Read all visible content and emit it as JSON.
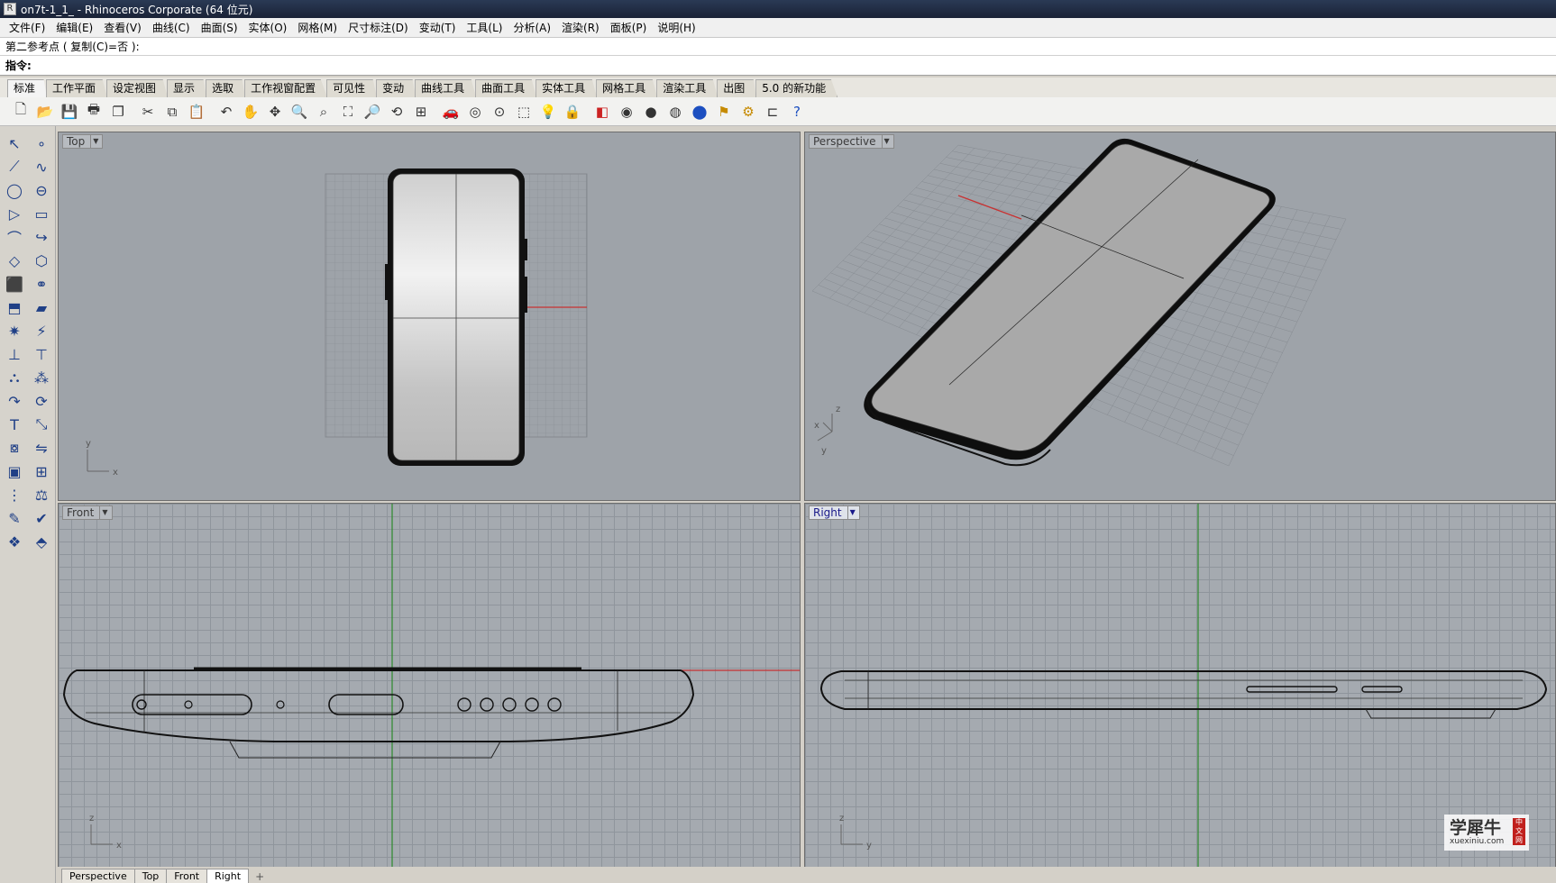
{
  "window": {
    "title": "on7t-1_1_ - Rhinoceros Corporate (64 位元)"
  },
  "menubar": {
    "items": [
      "文件(F)",
      "编辑(E)",
      "查看(V)",
      "曲线(C)",
      "曲面(S)",
      "实体(O)",
      "网格(M)",
      "尺寸标注(D)",
      "变动(T)",
      "工具(L)",
      "分析(A)",
      "渲染(R)",
      "面板(P)",
      "说明(H)"
    ]
  },
  "command": {
    "history": "第二参考点 ( 复制(C)=否 ):",
    "prompt": "指令:",
    "value": ""
  },
  "tabs": [
    "标准",
    "工作平面",
    "设定视图",
    "显示",
    "选取",
    "工作视窗配置",
    "可见性",
    "变动",
    "曲线工具",
    "曲面工具",
    "实体工具",
    "网格工具",
    "渲染工具",
    "出图",
    "5.0 的新功能"
  ],
  "toolbar": {
    "icons": [
      {
        "name": "new-file-icon",
        "glyph": "🗋"
      },
      {
        "name": "open-folder-icon",
        "glyph": "📂"
      },
      {
        "name": "save-icon",
        "glyph": "💾"
      },
      {
        "name": "print-icon",
        "glyph": "🖶"
      },
      {
        "name": "copy-file-icon",
        "glyph": "❐"
      },
      {
        "name": "cut-icon",
        "glyph": "✂"
      },
      {
        "name": "copy-icon",
        "glyph": "⧉"
      },
      {
        "name": "paste-icon",
        "glyph": "📋"
      },
      {
        "name": "undo-icon",
        "glyph": "↶"
      },
      {
        "name": "pan-hand-icon",
        "glyph": "✋"
      },
      {
        "name": "move-view-icon",
        "glyph": "✥"
      },
      {
        "name": "zoom-icon",
        "glyph": "🔍"
      },
      {
        "name": "zoom-window-icon",
        "glyph": "⌕"
      },
      {
        "name": "zoom-extents-icon",
        "glyph": "⛶"
      },
      {
        "name": "zoom-selected-icon",
        "glyph": "🔎"
      },
      {
        "name": "rotate-view-icon",
        "glyph": "⟲"
      },
      {
        "name": "four-viewports-icon",
        "glyph": "⊞"
      },
      {
        "name": "car-icon",
        "glyph": "🚗"
      },
      {
        "name": "grid-snap-icon",
        "glyph": "◎"
      },
      {
        "name": "osnap-icon",
        "glyph": "⊙"
      },
      {
        "name": "select-icon",
        "glyph": "⬚"
      },
      {
        "name": "lightbulb-icon",
        "glyph": "💡"
      },
      {
        "name": "lock-icon",
        "glyph": "🔒"
      },
      {
        "name": "layers-icon",
        "glyph": "◧"
      },
      {
        "name": "color-wheel-icon",
        "glyph": "◉"
      },
      {
        "name": "shaded-sphere-icon",
        "glyph": "●"
      },
      {
        "name": "rendered-sphere-icon",
        "glyph": "◍"
      },
      {
        "name": "blue-sphere-icon",
        "glyph": "⬤"
      },
      {
        "name": "flag-icon",
        "glyph": "⚑"
      },
      {
        "name": "options-gear-icon",
        "glyph": "⚙"
      },
      {
        "name": "dimension-icon",
        "glyph": "⊏"
      },
      {
        "name": "help-icon",
        "glyph": "?"
      }
    ]
  },
  "lefttools": {
    "icons": [
      {
        "name": "select-arrow-icon",
        "glyph": "↖"
      },
      {
        "name": "point-icon",
        "glyph": "∘"
      },
      {
        "name": "polyline-icon",
        "glyph": "⟋"
      },
      {
        "name": "curve-icon",
        "glyph": "∿"
      },
      {
        "name": "circle-icon",
        "glyph": "◯"
      },
      {
        "name": "ellipse-icon",
        "glyph": "⊖"
      },
      {
        "name": "polygon-icon",
        "glyph": "▷"
      },
      {
        "name": "rectangle-icon",
        "glyph": "▭"
      },
      {
        "name": "arc-icon",
        "glyph": "⌒"
      },
      {
        "name": "fillet-icon",
        "glyph": "↪"
      },
      {
        "name": "surface-icon",
        "glyph": "◇"
      },
      {
        "name": "loft-icon",
        "glyph": "⬡"
      },
      {
        "name": "box-icon",
        "glyph": "⬛"
      },
      {
        "name": "boolean-icon",
        "glyph": "⚭"
      },
      {
        "name": "extrude-icon",
        "glyph": "⬒"
      },
      {
        "name": "plane-icon",
        "glyph": "▰"
      },
      {
        "name": "explode-icon",
        "glyph": "✷"
      },
      {
        "name": "lightning-icon",
        "glyph": "⚡"
      },
      {
        "name": "trim-icon",
        "glyph": "⊥"
      },
      {
        "name": "split-icon",
        "glyph": "⊤"
      },
      {
        "name": "group-icon",
        "glyph": "⛬"
      },
      {
        "name": "ungroup-icon",
        "glyph": "⁂"
      },
      {
        "name": "rotate-icon",
        "glyph": "↷"
      },
      {
        "name": "rotate-3d-icon",
        "glyph": "⟳"
      },
      {
        "name": "text-icon",
        "glyph": "T"
      },
      {
        "name": "scale-icon",
        "glyph": "⤡"
      },
      {
        "name": "array-icon",
        "glyph": "⧇"
      },
      {
        "name": "mirror-icon",
        "glyph": "⇋"
      },
      {
        "name": "solid-box-icon",
        "glyph": "▣"
      },
      {
        "name": "dimension-tool-icon",
        "glyph": "⊞"
      },
      {
        "name": "mesh-grid-icon",
        "glyph": "⋮"
      },
      {
        "name": "analysis-icon",
        "glyph": "⚖"
      },
      {
        "name": "paint-icon",
        "glyph": "✎"
      },
      {
        "name": "check-icon",
        "glyph": "✔"
      },
      {
        "name": "render-icon",
        "glyph": "❖"
      },
      {
        "name": "material-icon",
        "glyph": "⬘"
      }
    ]
  },
  "viewports": {
    "top": {
      "label": "Top",
      "axis_x": "x",
      "axis_y": "y"
    },
    "perspective": {
      "label": "Perspective",
      "axis_x": "x",
      "axis_y": "y",
      "axis_z": "z"
    },
    "front": {
      "label": "Front",
      "axis_x": "x",
      "axis_z": "z"
    },
    "right": {
      "label": "Right",
      "axis_y": "y",
      "axis_z": "z"
    }
  },
  "bottomtabs": [
    "Perspective",
    "Top",
    "Front",
    "Right"
  ],
  "watermark": {
    "main": "学犀牛",
    "sub": "xuexiniu.com",
    "seal": "中文网"
  },
  "colors": {
    "x_axis": "#c83232",
    "y_axis": "#2d8a2d",
    "viewport_bg": "#9ea3a9",
    "grid": "#8f959c"
  }
}
